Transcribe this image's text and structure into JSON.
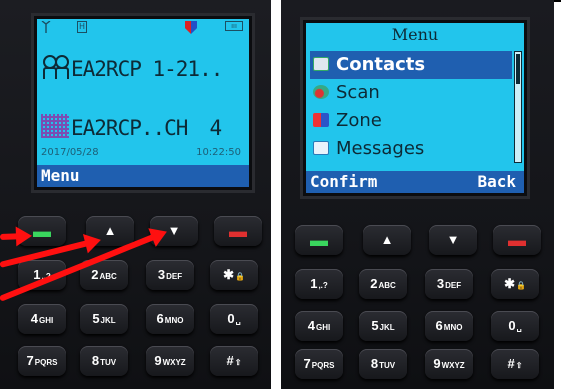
{
  "left_radio": {
    "status": {
      "sim_label": "H",
      "battery_label": "ııı"
    },
    "contact_line": "EA2RCP 1-21..",
    "channel_line": "EA2RCP..CH",
    "channel_number": "4",
    "date": "2017/05/28",
    "time": "10:22:50",
    "softkey_left": "Menu",
    "softkey_right": ""
  },
  "right_radio": {
    "menu_title": "Menu",
    "menu_items": [
      {
        "label": "Contacts",
        "icon": "contacts-icon",
        "selected": true
      },
      {
        "label": "Scan",
        "icon": "scan-icon",
        "selected": false
      },
      {
        "label": "Zone",
        "icon": "zone-icon",
        "selected": false
      },
      {
        "label": "Messages",
        "icon": "messages-icon",
        "selected": false
      }
    ],
    "softkey_left": "Confirm",
    "softkey_right": "Back"
  },
  "keypad": {
    "row1": [
      "green-call",
      "up",
      "down",
      "red-end"
    ],
    "row2": [
      [
        "1",
        ",.?"
      ],
      [
        "2",
        "ABC"
      ],
      [
        "3",
        "DEF"
      ],
      [
        "*",
        "lock"
      ]
    ],
    "row3": [
      [
        "4",
        "GHI"
      ],
      [
        "5",
        "JKL"
      ],
      [
        "6",
        "MNO"
      ],
      [
        "0",
        "space"
      ]
    ],
    "row4": [
      [
        "7",
        "PQRS"
      ],
      [
        "8",
        "TUV"
      ],
      [
        "9",
        "WXYZ"
      ],
      [
        "#",
        "shift"
      ]
    ]
  },
  "annotation_colors": {
    "arrow": "#ff1010",
    "screen": "#22c5ec",
    "softbar": "#1f5fb0"
  }
}
